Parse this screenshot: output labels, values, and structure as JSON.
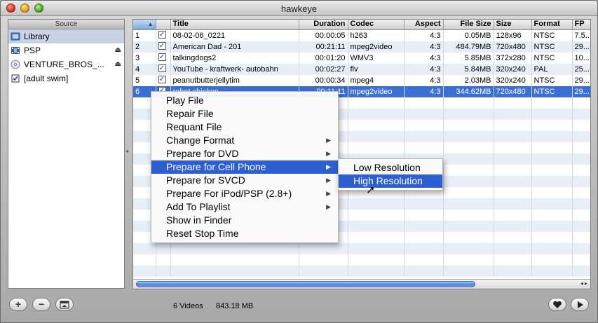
{
  "window": {
    "title": "hawkeye"
  },
  "source": {
    "header": "Source",
    "items": [
      {
        "label": "Library",
        "icon": "library-icon",
        "eject": false
      },
      {
        "label": "PSP",
        "icon": "film-icon",
        "eject": true
      },
      {
        "label": "VENTURE_BROS_...",
        "icon": "dvd-icon",
        "eject": true
      },
      {
        "label": "[adult swim]",
        "icon": "playlist-icon",
        "eject": false
      }
    ]
  },
  "table": {
    "columns": [
      "",
      "",
      "Title",
      "Duration",
      "Codec",
      "Aspect",
      "File Size",
      "Size",
      "Format",
      "FP"
    ],
    "rows": [
      {
        "num": "1",
        "title": "08-02-06_0221",
        "duration": "00:00:05",
        "codec": "h263",
        "aspect": "4:3",
        "file_size": "0.05MB",
        "size": "128x96",
        "format": "NTSC",
        "fp": "7.5..."
      },
      {
        "num": "2",
        "title": "American Dad - 201",
        "duration": "00:21:11",
        "codec": "mpeg2video",
        "aspect": "4:3",
        "file_size": "484.79MB",
        "size": "720x480",
        "format": "NTSC",
        "fp": "29..."
      },
      {
        "num": "3",
        "title": "talkingdogs2",
        "duration": "00:01:20",
        "codec": "WMV3",
        "aspect": "4:3",
        "file_size": "5.85MB",
        "size": "372x280",
        "format": "NTSC",
        "fp": "10..."
      },
      {
        "num": "4",
        "title": "YouTube - kraftwerk- autobahn",
        "duration": "00:02:27",
        "codec": "flv",
        "aspect": "4:3",
        "file_size": "5.84MB",
        "size": "320x240",
        "format": "PAL",
        "fp": "25..."
      },
      {
        "num": "5",
        "title": "peanutbutterjellytim",
        "duration": "00:00:34",
        "codec": "mpeg4",
        "aspect": "4:3",
        "file_size": "2.03MB",
        "size": "320x240",
        "format": "NTSC",
        "fp": "29..."
      },
      {
        "num": "6",
        "title": "robot chicken",
        "duration": "00:11:11",
        "codec": "mpeg2video",
        "aspect": "4:3",
        "file_size": "344.62MB",
        "size": "720x480",
        "format": "NTSC",
        "fp": "29..."
      }
    ]
  },
  "context_menu": {
    "items": [
      {
        "label": "Play File",
        "submenu": false
      },
      {
        "label": "Repair File",
        "submenu": false
      },
      {
        "label": "Requant File",
        "submenu": false
      },
      {
        "label": "Change Format",
        "submenu": true
      },
      {
        "label": "Prepare for DVD",
        "submenu": true
      },
      {
        "label": "Prepare for Cell Phone",
        "submenu": true
      },
      {
        "label": "Prepare for SVCD",
        "submenu": true
      },
      {
        "label": "Prepare For iPod/PSP (2.8+)",
        "submenu": true
      },
      {
        "label": "Add To Playlist",
        "submenu": true
      },
      {
        "label": "Show in Finder",
        "submenu": false
      },
      {
        "label": "Reset Stop Time",
        "submenu": false
      }
    ]
  },
  "submenu": {
    "items": [
      {
        "label": "Low Resolution"
      },
      {
        "label": "High Resolution"
      }
    ]
  },
  "status": {
    "count": "6 Videos",
    "total_size": "843.18 MB"
  },
  "colors": {
    "selection": "#3b6fd3",
    "menu_highlight": "#2d5fd2",
    "alt_row": "#e8eef8"
  }
}
